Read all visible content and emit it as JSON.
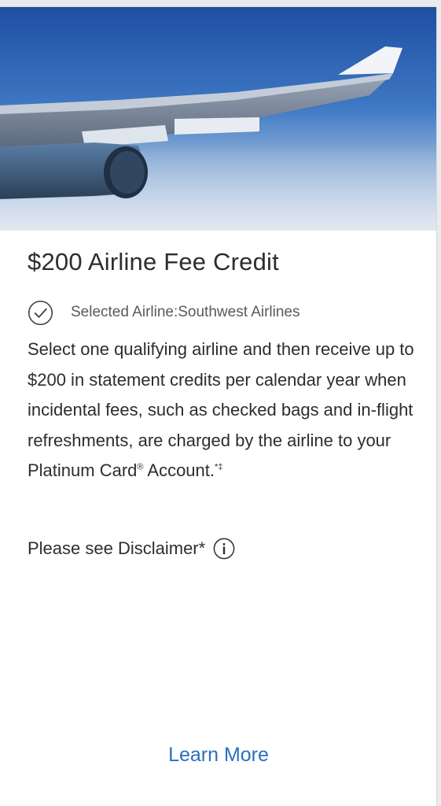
{
  "card": {
    "image": {
      "icon": "airplane-wing-photo"
    },
    "title": "$200 Airline Fee Credit",
    "selected": {
      "icon": "check-circle-icon",
      "text": "Selected Airline:Southwest Airlines"
    },
    "description": {
      "text": "Select one qualifying airline and then receive up to $200 in statement credits per calendar year when incidental fees, such as checked bags and in-flight refreshments, are charged by the airline to your Platinum Card",
      "registered_mark": "®",
      "tail": " Account.",
      "footnote_marks": "*‡"
    },
    "disclaimer": {
      "label": "Please see Disclaimer*",
      "icon": "info-icon"
    },
    "learn_more": "Learn More"
  },
  "colors": {
    "link": "#2a6fbe",
    "text": "#2d2d2d",
    "muted_text": "#5a5a5a",
    "sky_top": "#1d4fa3",
    "sky_bottom": "#c9d7ea"
  }
}
